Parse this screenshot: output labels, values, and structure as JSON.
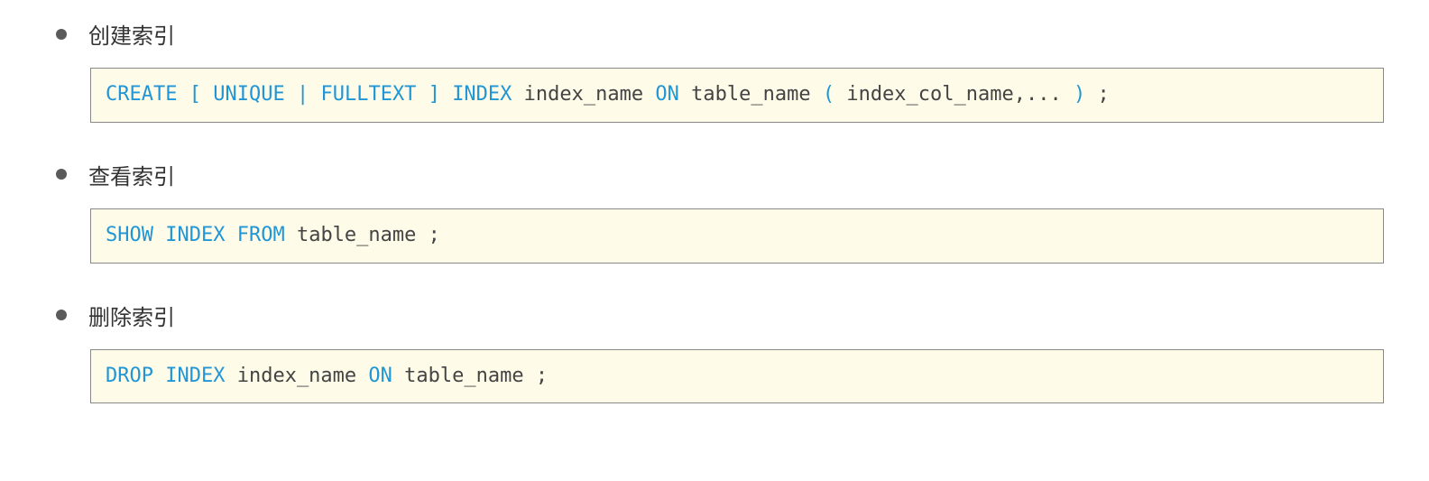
{
  "sections": [
    {
      "title": "创建索引",
      "code": {
        "k1": "CREATE",
        "s1": " [ ",
        "k2": "UNIQUE",
        "s2": " | ",
        "k3": "FULLTEXT",
        "s3": " ] ",
        "k4": "INDEX",
        "t1": " index_name ",
        "k5": "ON",
        "t2": " table_name ",
        "s4": "(",
        "t3": " index_col_name,... ",
        "s5": ")",
        "t4": " ;"
      }
    },
    {
      "title": "查看索引",
      "code": {
        "k1": "SHOW",
        "sp1": "  ",
        "k2": "INDEX",
        "sp2": "  ",
        "k3": "FROM",
        "t1": "  table_name ;"
      }
    },
    {
      "title": "删除索引",
      "code": {
        "k1": "DROP",
        "sp1": "  ",
        "k2": "INDEX",
        "t1": "  index_name  ",
        "k3": "ON",
        "t2": "  table_name ;"
      }
    }
  ]
}
